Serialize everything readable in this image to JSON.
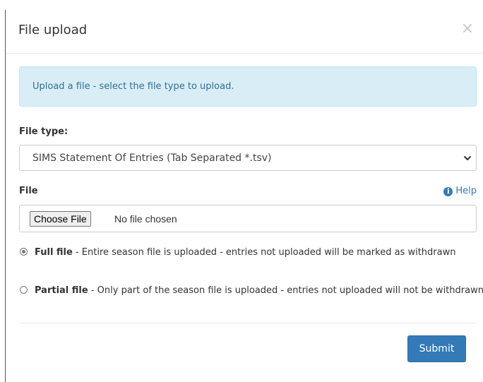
{
  "modal": {
    "title": "File upload",
    "close_label": "×"
  },
  "alert": {
    "text": "Upload a file - select the file type to upload."
  },
  "file_type": {
    "label": "File type:",
    "selected": "SIMS Statement Of Entries (Tab Separated *.tsv)"
  },
  "file": {
    "label": "File",
    "help_label": "Help",
    "button_label": "Choose File",
    "status": "No file chosen"
  },
  "options": [
    {
      "title": "Full file",
      "description": " - Entire season file is uploaded - entries not uploaded will be marked as withdrawn",
      "checked": true
    },
    {
      "title": "Partial file",
      "description": " - Only part of the season file is uploaded - entries not uploaded will not be withdrawn",
      "checked": false
    }
  ],
  "footer": {
    "submit_label": "Submit"
  },
  "colors": {
    "primary": "#337ab7",
    "alert_bg": "#d9edf7",
    "alert_text": "#31708f"
  },
  "icons": {
    "help": "info-circle-icon",
    "select": "chevron-down-icon",
    "close": "close-icon"
  }
}
